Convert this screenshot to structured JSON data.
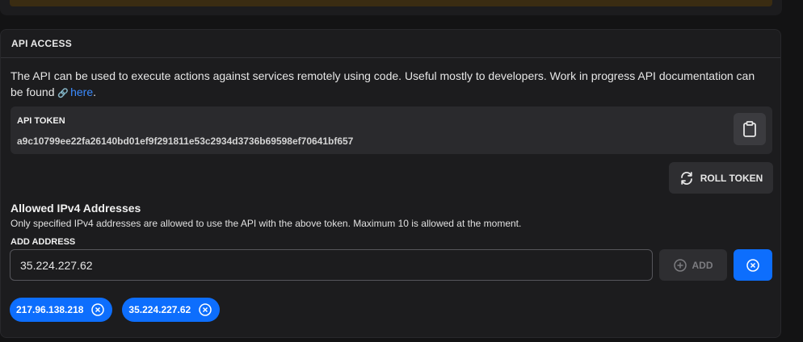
{
  "api_access": {
    "header": "API ACCESS",
    "description": "The API can be used to execute actions against services remotely using code. Useful mostly to developers. Work in progress API documentation can be found ",
    "doc_link": "here",
    "description_end": ".",
    "token_label": "API TOKEN",
    "token_value": "a9c10799ee22fa26140bd01ef9f291811e53c2934d3736b69598ef70641bf657",
    "roll_label": "ROLL TOKEN"
  },
  "ipv4": {
    "title": "Allowed IPv4 Addresses",
    "subtitle": "Only specified IPv4 addresses are allowed to use the API with the above token. Maximum 10 is allowed at the moment.",
    "add_label": "ADD ADDRESS",
    "input_value": "35.224.227.62",
    "add_button": "ADD",
    "addresses": [
      "217.96.138.218",
      "35.224.227.62"
    ]
  },
  "icons": {
    "copy": "clipboard-icon",
    "roll": "refresh-icon",
    "add": "plus-circle-icon",
    "clear": "x-circle-icon",
    "link": "link-icon"
  },
  "colors": {
    "accent": "#0d6efd",
    "link": "#3b8bff"
  }
}
